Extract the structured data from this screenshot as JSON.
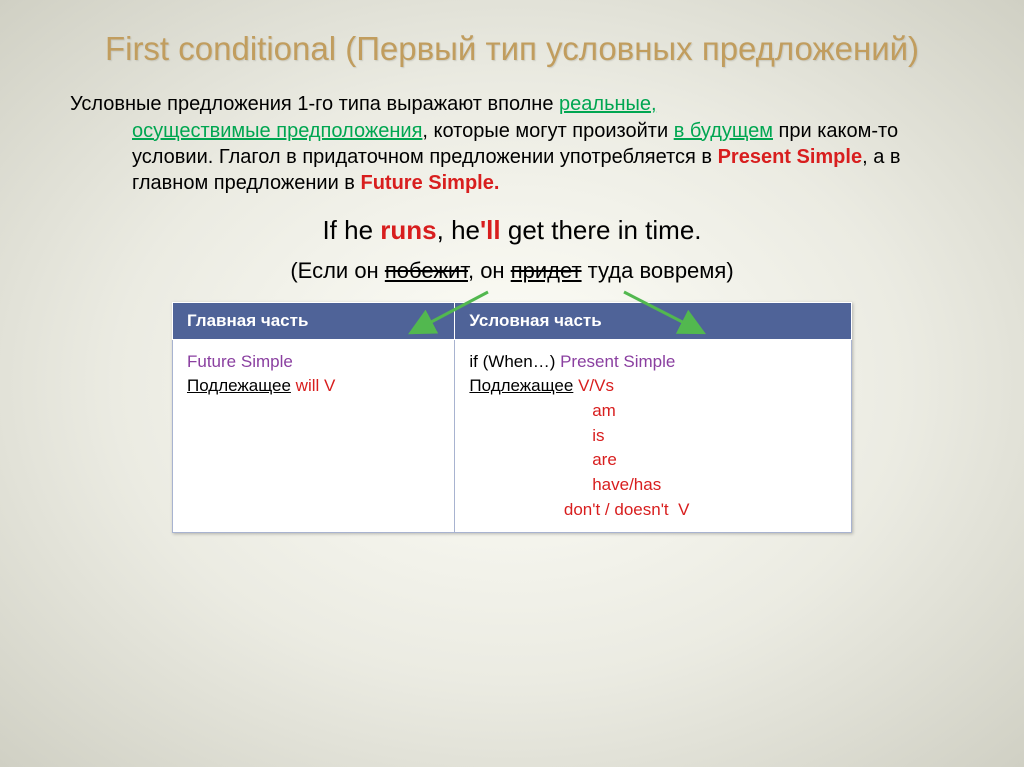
{
  "title": "First conditional (Первый тип условных предложений)",
  "para": {
    "l1a": "Условные предложения 1-го типа выражают вполне ",
    "l1b": "реальные, ",
    "l2a": "осуществимые предположения",
    "l2b": ", которые могут произойти ",
    "l2c": "в будущем",
    "l3": " при каком-то условии. Глагол в придаточном предложении употребляется в ",
    "l3b": "Present Simple",
    "l3c": ", а в главном предложении в ",
    "l3d": "Future Simple.",
    "l3e": ""
  },
  "example": {
    "a": "If he ",
    "b": "runs",
    "c": ", he",
    "d": "'ll",
    "e": " get there in time."
  },
  "translation": {
    "a": "(Если он ",
    "b": "побежит",
    "c": ", он ",
    "d": "придет",
    "e": " туда вовремя)"
  },
  "table": {
    "h1": "Главная часть",
    "h2": "Условная часть",
    "c1": {
      "l1": "Future Simple",
      "l2a": "Подлежащее",
      "l2b": " will  V"
    },
    "c2": {
      "l1a": "if (When…) ",
      "l1b": "Present Simple",
      "l2a": "Подлежащее",
      "l2b": "  V/Vs",
      "l3": "                          am",
      "l4": "                          is",
      "l5": "                          are",
      "l6": "                          have/has",
      "l7": "                    don't / doesn't  V"
    }
  }
}
